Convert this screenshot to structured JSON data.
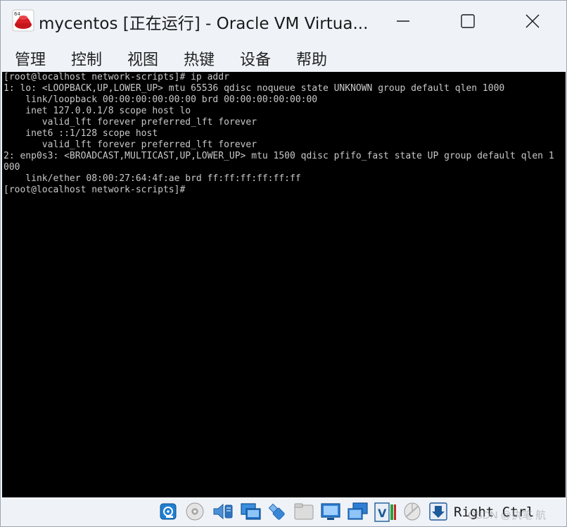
{
  "window": {
    "title": "mycentos [正在运行] - Oracle VM Virtua...",
    "app_icon_badge": "64",
    "controls": [
      "minimize",
      "maximize",
      "close"
    ]
  },
  "menubar": {
    "items": [
      {
        "label": "管理"
      },
      {
        "label": "控制"
      },
      {
        "label": "视图"
      },
      {
        "label": "热键"
      },
      {
        "label": "设备"
      },
      {
        "label": "帮助"
      }
    ]
  },
  "console": {
    "lines": [
      "[root@localhost network-scripts]# ip addr",
      "1: lo: <LOOPBACK,UP,LOWER_UP> mtu 65536 qdisc noqueue state UNKNOWN group default qlen 1000",
      "    link/loopback 00:00:00:00:00:00 brd 00:00:00:00:00:00",
      "    inet 127.0.0.1/8 scope host lo",
      "       valid_lft forever preferred_lft forever",
      "    inet6 ::1/128 scope host",
      "       valid_lft forever preferred_lft forever",
      "2: enp0s3: <BROADCAST,MULTICAST,UP,LOWER_UP> mtu 1500 qdisc pfifo_fast state UP group default qlen 1",
      "000",
      "    link/ether 08:00:27:64:4f:ae brd ff:ff:ff:ff:ff:ff",
      "[root@localhost network-scripts]#"
    ]
  },
  "statusbar": {
    "icons": [
      "hard-disk-icon",
      "optical-drive-icon",
      "audio-icon",
      "network-icon",
      "usb-icon",
      "shared-folders-icon",
      "display-icon",
      "video-capture-icon",
      "cpu-virtualization-icon",
      "mouse-integration-icon",
      "keyboard-capture-icon"
    ],
    "host_key": "Right Ctrl",
    "watermark": "CSDN @执笔 航"
  },
  "colors": {
    "console_bg": "#000000",
    "console_fg": "#c8c8c8",
    "chrome_bg": "#eff3f8"
  }
}
